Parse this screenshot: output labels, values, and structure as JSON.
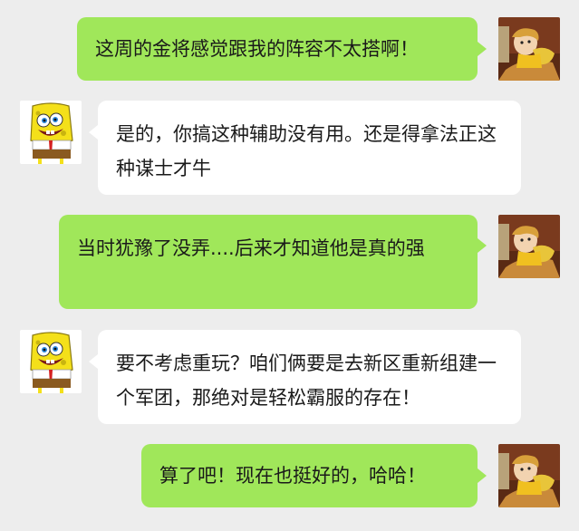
{
  "chat": {
    "messages": [
      {
        "side": "right",
        "sender": "boy-avatar",
        "text": "这周的金将感觉跟我的阵容不太搭啊！"
      },
      {
        "side": "left",
        "sender": "sponge-avatar",
        "text": "是的，你搞这种辅助没有用。还是得拿法正这种谋士才牛"
      },
      {
        "side": "right",
        "sender": "boy-avatar",
        "text": "当时犹豫了没弄....后来才知道他是真的强"
      },
      {
        "side": "left",
        "sender": "sponge-avatar",
        "text": "要不考虑重玩？咱们俩要是去新区重新组建一个军团，那绝对是轻松霸服的存在！"
      },
      {
        "side": "right",
        "sender": "boy-avatar",
        "text": "算了吧！现在也挺好的，哈哈！"
      }
    ]
  },
  "colors": {
    "background": "#ededed",
    "right_bubble": "#a0e75a",
    "left_bubble": "#ffffff",
    "text": "#1a1a1a"
  }
}
